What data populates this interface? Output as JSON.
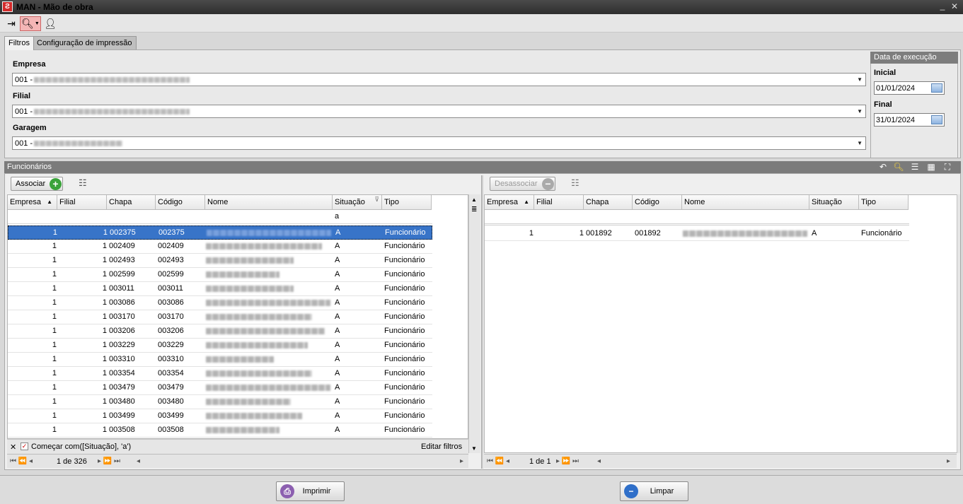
{
  "window": {
    "title": "MAN - Mão de obra",
    "app_icon": "app-logo-icon"
  },
  "toolbar": {
    "exit_icon": "exit-icon",
    "search_icon": "search-icon",
    "user_icon": "user-icon"
  },
  "tabs": [
    {
      "label": "Filtros"
    },
    {
      "label": "Configuração de impressão"
    }
  ],
  "filters": {
    "empresa_label": "Empresa",
    "empresa_value": "001 -",
    "filial_label": "Filial",
    "filial_value": "001 -",
    "garagem_label": "Garagem",
    "garagem_value": "001 -"
  },
  "date_execution": {
    "title": "Data de execução",
    "inicial_label": "Inicial",
    "inicial_value": "01/01/2024",
    "final_label": "Final",
    "final_value": "31/01/2024"
  },
  "panel": {
    "title": "Funcionários"
  },
  "left_grid": {
    "associar_label": "Associar",
    "columns": [
      "Empresa",
      "Filial",
      "Chapa",
      "Código",
      "Nome",
      "Situação",
      "Tipo"
    ],
    "filter_situacao": "a",
    "rows": [
      {
        "empresa": "1",
        "filial": "1",
        "chapa": "002375",
        "codigo": "002375",
        "situacao": "A",
        "tipo": "Funcionário"
      },
      {
        "empresa": "1",
        "filial": "1",
        "chapa": "002409",
        "codigo": "002409",
        "situacao": "A",
        "tipo": "Funcionário"
      },
      {
        "empresa": "1",
        "filial": "1",
        "chapa": "002493",
        "codigo": "002493",
        "situacao": "A",
        "tipo": "Funcionário"
      },
      {
        "empresa": "1",
        "filial": "1",
        "chapa": "002599",
        "codigo": "002599",
        "situacao": "A",
        "tipo": "Funcionário"
      },
      {
        "empresa": "1",
        "filial": "1",
        "chapa": "003011",
        "codigo": "003011",
        "situacao": "A",
        "tipo": "Funcionário"
      },
      {
        "empresa": "1",
        "filial": "1",
        "chapa": "003086",
        "codigo": "003086",
        "situacao": "A",
        "tipo": "Funcionário"
      },
      {
        "empresa": "1",
        "filial": "1",
        "chapa": "003170",
        "codigo": "003170",
        "situacao": "A",
        "tipo": "Funcionário"
      },
      {
        "empresa": "1",
        "filial": "1",
        "chapa": "003206",
        "codigo": "003206",
        "situacao": "A",
        "tipo": "Funcionário"
      },
      {
        "empresa": "1",
        "filial": "1",
        "chapa": "003229",
        "codigo": "003229",
        "situacao": "A",
        "tipo": "Funcionário"
      },
      {
        "empresa": "1",
        "filial": "1",
        "chapa": "003310",
        "codigo": "003310",
        "situacao": "A",
        "tipo": "Funcionário"
      },
      {
        "empresa": "1",
        "filial": "1",
        "chapa": "003354",
        "codigo": "003354",
        "situacao": "A",
        "tipo": "Funcionário"
      },
      {
        "empresa": "1",
        "filial": "1",
        "chapa": "003479",
        "codigo": "003479",
        "situacao": "A",
        "tipo": "Funcionário"
      },
      {
        "empresa": "1",
        "filial": "1",
        "chapa": "003480",
        "codigo": "003480",
        "situacao": "A",
        "tipo": "Funcionário"
      },
      {
        "empresa": "1",
        "filial": "1",
        "chapa": "003499",
        "codigo": "003499",
        "situacao": "A",
        "tipo": "Funcionário"
      },
      {
        "empresa": "1",
        "filial": "1",
        "chapa": "003508",
        "codigo": "003508",
        "situacao": "A",
        "tipo": "Funcionário"
      }
    ],
    "filter_text": "Começar com([Situação], 'a')",
    "edit_filters": "Editar filtros",
    "pager": "1 de 326"
  },
  "right_grid": {
    "desassociar_label": "Desassociar",
    "columns": [
      "Empresa",
      "Filial",
      "Chapa",
      "Código",
      "Nome",
      "Situação",
      "Tipo"
    ],
    "rows": [
      {
        "empresa": "1",
        "filial": "1",
        "chapa": "001892",
        "codigo": "001892",
        "situacao": "A",
        "tipo": "Funcionário"
      }
    ],
    "pager": "1 de 1"
  },
  "footer": {
    "imprimir_label": "Imprimir",
    "limpar_label": "Limpar"
  },
  "colors": {
    "selection": "#3874c8",
    "header_bg": "#7b7b7b",
    "add": "#3aa33a"
  }
}
